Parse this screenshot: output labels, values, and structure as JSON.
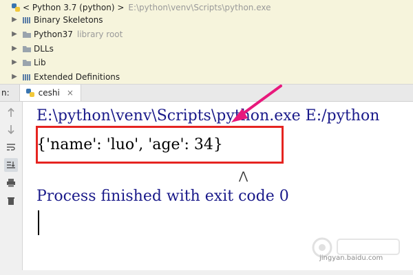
{
  "tree": {
    "header": {
      "label": "< Python 3.7 (python) >",
      "path": "E:\\python\\venv\\Scripts\\python.exe"
    },
    "items": [
      {
        "label": "Binary Skeletons",
        "note": "",
        "icon": "library-icon"
      },
      {
        "label": "Python37",
        "note": "library root",
        "icon": "folder-icon"
      },
      {
        "label": "DLLs",
        "note": "",
        "icon": "folder-icon"
      },
      {
        "label": "Lib",
        "note": "",
        "icon": "folder-icon"
      },
      {
        "label": "Extended Definitions",
        "note": "",
        "icon": "library-icon"
      }
    ]
  },
  "run_panel": {
    "side_label": "n:",
    "tab_label": "ceshi",
    "close_glyph": "×"
  },
  "console": {
    "command": "E:\\python\\venv\\Scripts\\python.exe E:/python",
    "output": "{'name': 'luo', 'age': 34}",
    "exit_message": "Process finished with exit code 0"
  },
  "watermark": {
    "text": "jingyan.baidu.com"
  },
  "colors": {
    "highlight": "#e52420",
    "arrow": "#e8197c",
    "console_text": "#1a1a8a"
  }
}
